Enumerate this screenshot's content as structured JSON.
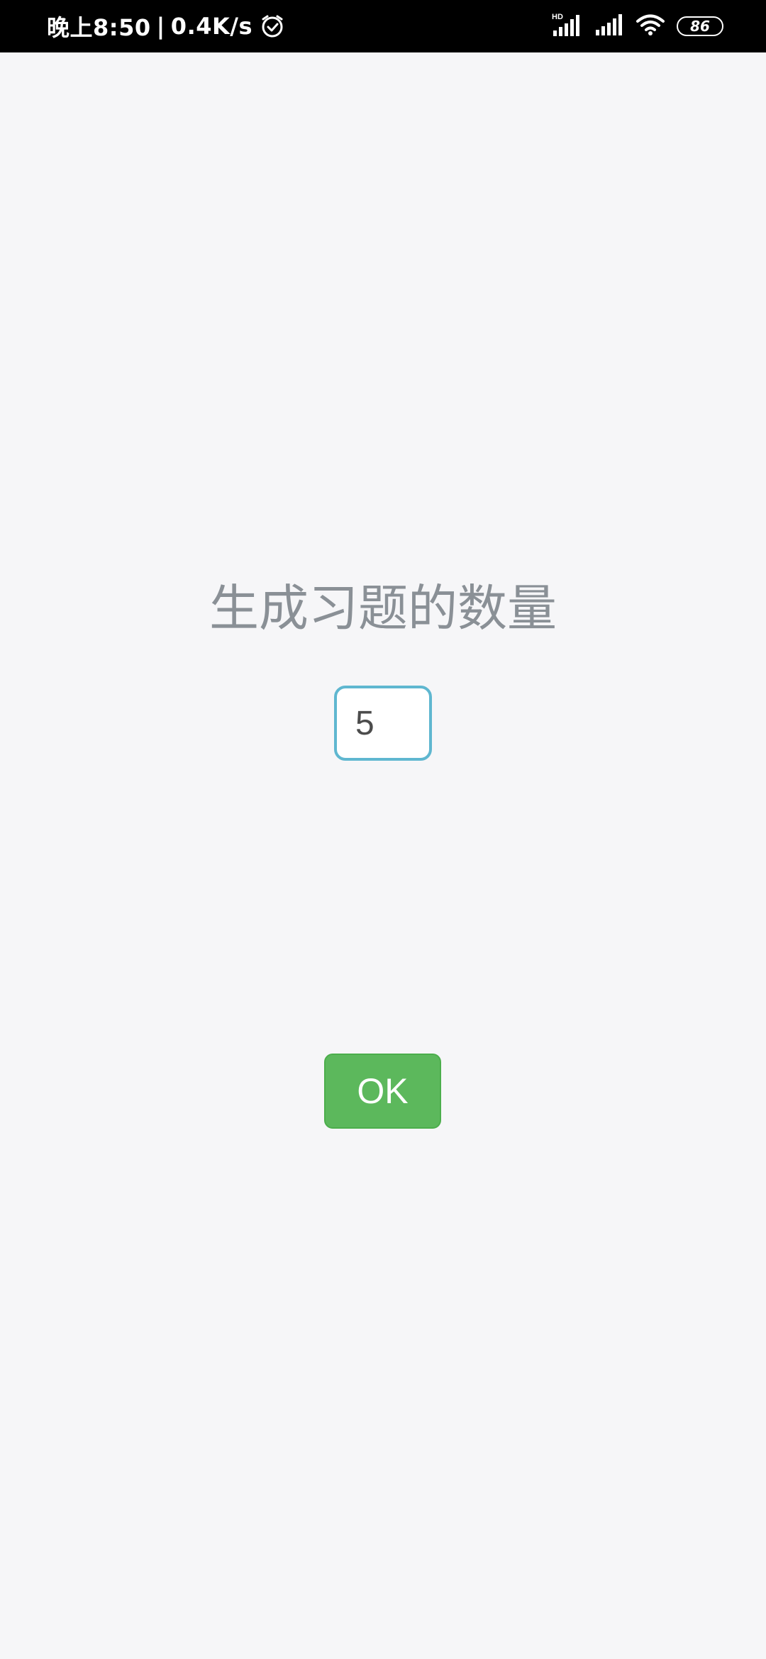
{
  "status_bar": {
    "time": "晚上8:50",
    "separator": "|",
    "speed": "0.4K/s",
    "hd_label": "HD",
    "battery": "86"
  },
  "main": {
    "title": "生成习题的数量",
    "count_value": "5",
    "ok_label": "OK"
  },
  "colors": {
    "background": "#f6f6f8",
    "title": "#8a9096",
    "input_border": "#5fb7d0",
    "button": "#5cb85c"
  }
}
